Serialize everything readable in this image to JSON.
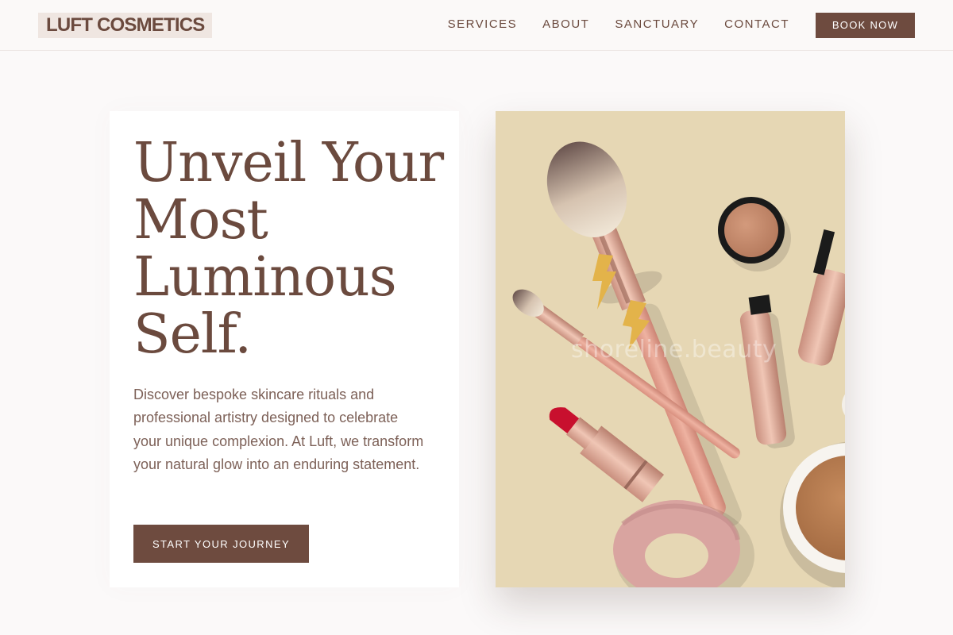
{
  "header": {
    "logo": "LUFT COSMETICS",
    "nav": [
      "SERVICES",
      "ABOUT",
      "SANCTUARY",
      "CONTACT"
    ],
    "book_label": "BOOK NOW"
  },
  "hero": {
    "headline_lines": [
      "Unveil Your",
      "Most",
      "Luminous",
      "Self."
    ],
    "description": "Discover bespoke skincare rituals and professional artistry designed to celebrate your unique complexion. At Luft, we transform your natural glow into an enduring statement.",
    "cta_label": "START YOUR JOURNEY",
    "image_watermark": "shoreline.beauty"
  },
  "colors": {
    "brand": "#6e4b3f",
    "logo_bg": "#efe6e1",
    "page_bg": "#fbf9f9",
    "image_bg": "#e6d7b4"
  }
}
